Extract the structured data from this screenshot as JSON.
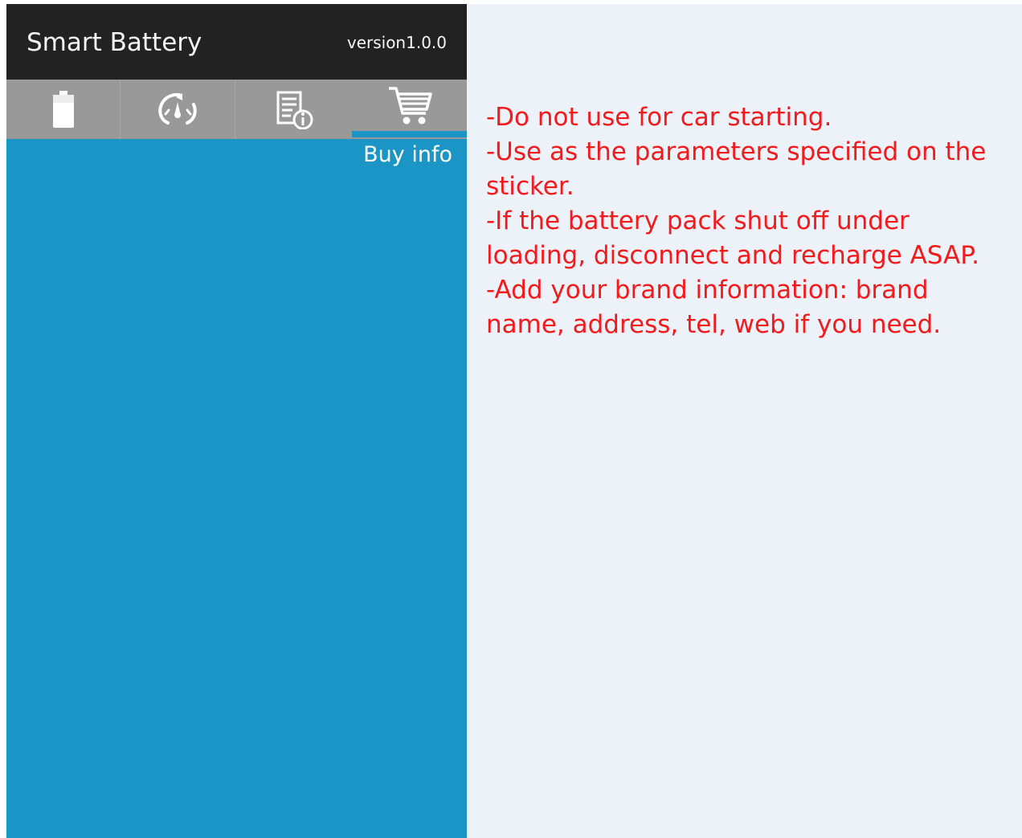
{
  "app": {
    "title": "Smart Battery",
    "version": "version1.0.0"
  },
  "tabs": [
    {
      "icon": "battery-icon",
      "active": false
    },
    {
      "icon": "speedometer-icon",
      "active": false
    },
    {
      "icon": "document-info-icon",
      "active": false
    },
    {
      "icon": "shopping-cart-icon",
      "active": true
    }
  ],
  "active_tab_label": "Buy info",
  "notes": [
    "-Do not use for car starting.",
    "-Use as the parameters specified on the sticker.",
    "-If the battery pack shut off under loading, disconnect and recharge ASAP.",
    "-Add your brand information: brand name, address, tel, web if you need."
  ],
  "colors": {
    "header_bg": "#222222",
    "tabbar_bg": "#999999",
    "content_bg": "#1a95c5",
    "panel_bg": "#edf1f8",
    "note_text": "#f21a1a"
  }
}
